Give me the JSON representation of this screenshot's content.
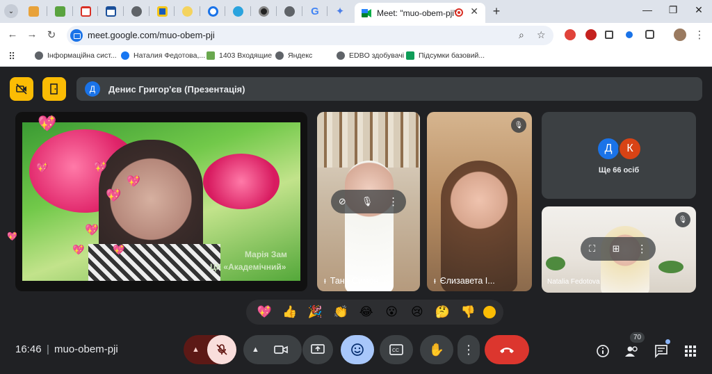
{
  "browser": {
    "tab_active_title": "Meet: \"muo-obem-pji\"",
    "new_tab_label": "+",
    "url": "meet.google.com/muo-obem-pji",
    "bookmarks": [
      {
        "label": "Інформаційна сист..."
      },
      {
        "label": "Наталия Федотова,..."
      },
      {
        "label": "1403 Входящие"
      },
      {
        "label": "Яндекс"
      },
      {
        "label": "EDBO здобувачі"
      },
      {
        "label": "Підсумки базовий..."
      }
    ],
    "tabs": [
      "gift",
      "drive-green",
      "gmail",
      "calendar",
      "globe",
      "yellow-doc",
      "chat",
      "edge",
      "telegram",
      "ring",
      "globe2",
      "google",
      "gemini"
    ]
  },
  "meet": {
    "presenter_initial": "Д",
    "presenter_label": "Денис Григор'єв (Презентація)",
    "participants": [
      {
        "name": "Марія Зам...",
        "caption": "Марія Зам",
        "subcaption": "ЦК «Академічний»"
      },
      {
        "name": "Таня Симон..."
      },
      {
        "name": "Єлизавета І..."
      },
      {
        "name": "Natalia Fedotova"
      }
    ],
    "others": {
      "label": "Ще 66 осіб",
      "avatars": [
        {
          "initial": "Д",
          "color": "#1a73e8"
        },
        {
          "initial": "К",
          "color": "#d84315"
        }
      ]
    },
    "reactions": [
      "💖",
      "👍",
      "🎉",
      "👏",
      "😂",
      "😮",
      "😢",
      "🤔",
      "👎"
    ],
    "clock": "16:46",
    "meeting_code": "muo-obem-pji",
    "people_count": "70"
  }
}
